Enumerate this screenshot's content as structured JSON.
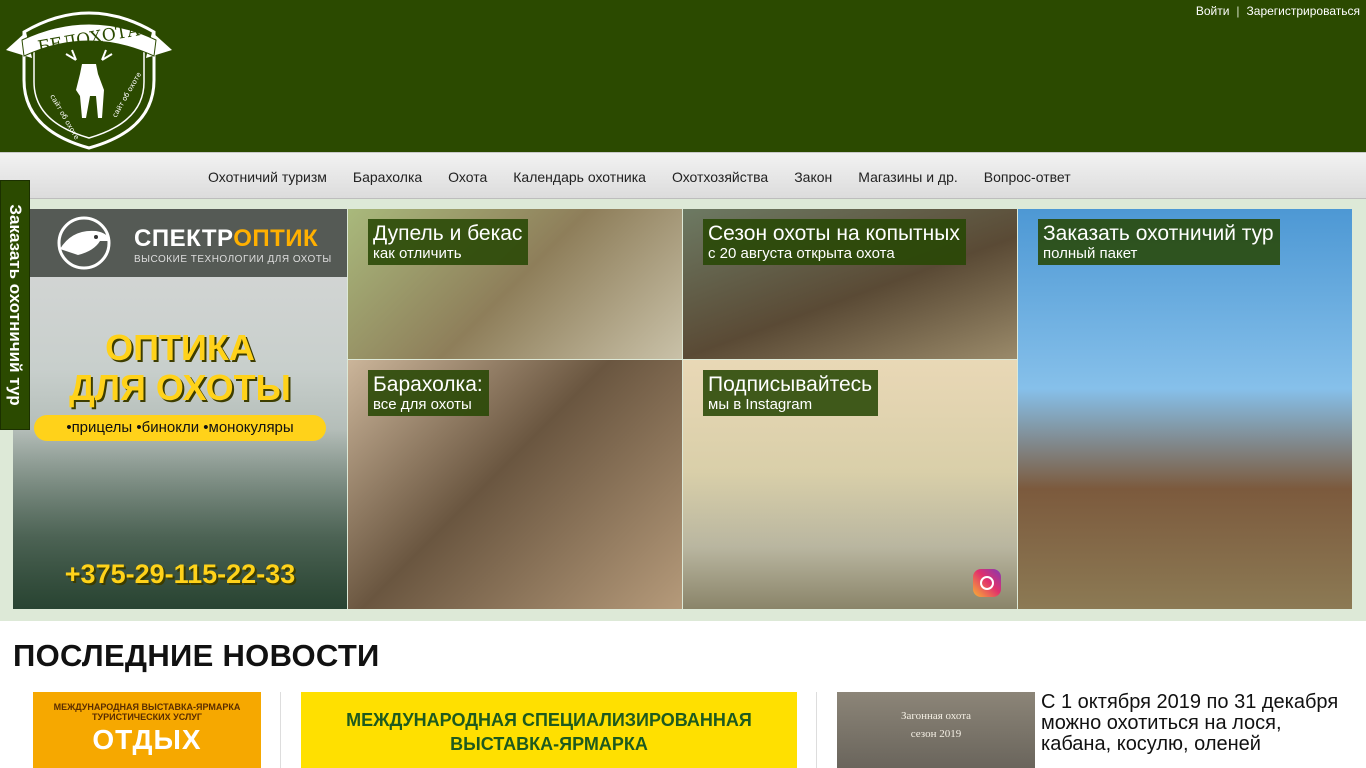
{
  "site": {
    "logo_text": "БЕЛОХОТА",
    "logo_side_text": "сайт об охоте"
  },
  "auth": {
    "login": "Войти",
    "separator": "|",
    "register": "Зарегистрироваться"
  },
  "nav": {
    "items": [
      "Охотничий туризм",
      "Барахолка",
      "Охота",
      "Календарь охотника",
      "Охотхозяйства",
      "Закон",
      "Магазины и др.",
      "Вопрос-ответ"
    ]
  },
  "side_tab": {
    "label": "Заказать охотничий тур"
  },
  "ad": {
    "brand_main": "СПЕКТР",
    "brand_accent": "ОПТИК",
    "tagline": "ВЫСОКИЕ ТЕХНОЛОГИИ ДЛЯ ОХОТЫ",
    "headline_1": "ОПТИКА",
    "headline_2": "ДЛЯ ОХОТЫ",
    "products": "•прицелы •бинокли •монокуляры",
    "phone": "+375-29-115-22-33"
  },
  "tiles": {
    "snipe": {
      "title": "Дупель и бекас",
      "subtitle": "как отличить"
    },
    "season": {
      "title": "Сезон охоты на копытных",
      "subtitle": "с 20 августа открыта охота"
    },
    "tour": {
      "title": "Заказать охотничий тур",
      "subtitle": "полный пакет"
    },
    "market": {
      "title": "Барахолка:",
      "subtitle": "все для охоты"
    },
    "instagram": {
      "title": "Подписывайтесь",
      "subtitle": "мы в Instagram"
    }
  },
  "news": {
    "heading": "ПОСЛЕДНИЕ НОВОСТИ",
    "item1": {
      "small": "МЕЖДУНАРОДНАЯ ВЫСТАВКА-ЯРМАРКА ТУРИСТИЧЕСКИХ УСЛУГ",
      "big": "ОТДЫХ"
    },
    "item2": {
      "line_a": "МЕЖДУНАРОДНАЯ СПЕЦИАЛИЗИРОВАННАЯ",
      "line_b": "ВЫСТАВКА-ЯРМАРКА"
    },
    "item3": {
      "img_line_1": "Загонная охота",
      "img_line_2": "сезон 2019",
      "text": "С 1 октября 2019 по 31 декабря можно охотиться на лося, кабана, косулю, оленей"
    }
  },
  "colors": {
    "header_green": "#2b4a00",
    "caption_bg": "#284804",
    "promo_bg": "#dde9d7",
    "accent_yellow": "#ffd21a"
  }
}
